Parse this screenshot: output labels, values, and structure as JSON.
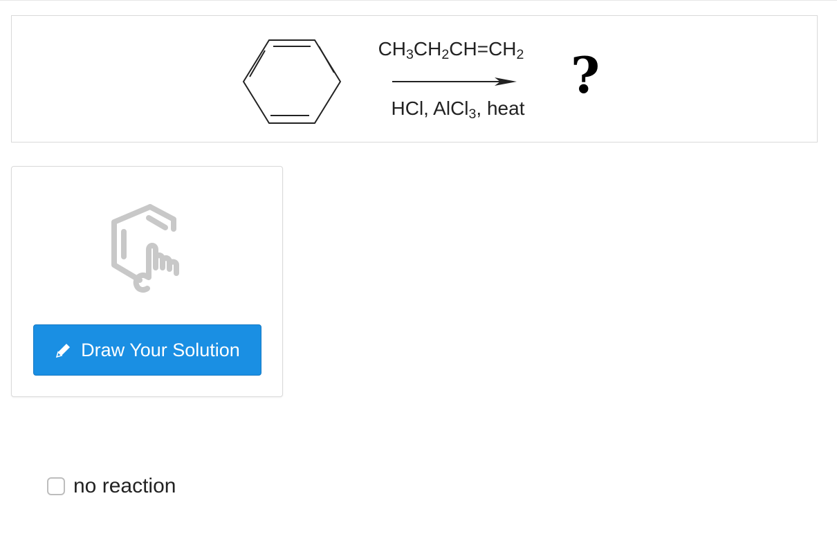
{
  "reaction": {
    "reagent_top": {
      "a": "CH",
      "a_sub": "3",
      "b": "CH",
      "b_sub": "2",
      "c": "CH=CH",
      "c_sub": "2"
    },
    "reagent_bottom": {
      "a": "HCl, AlCl",
      "a_sub": "3",
      "b": ", heat"
    },
    "product": "?"
  },
  "draw_card": {
    "button_label": "Draw Your Solution",
    "icon": "molecule-drawing-icon"
  },
  "option": {
    "label": "no reaction",
    "checked": false
  },
  "colors": {
    "button_bg": "#1a8fe3",
    "border": "#d9d9d9",
    "icon_gray": "#c8c8c8"
  }
}
